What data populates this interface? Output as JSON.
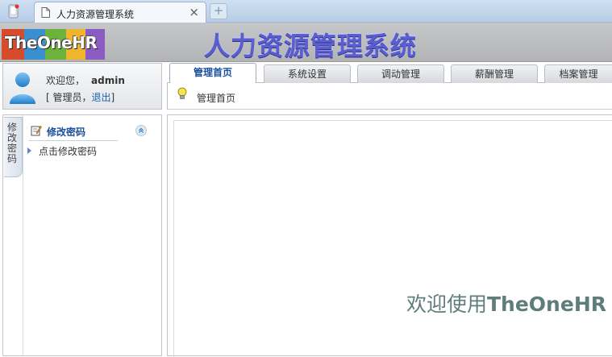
{
  "browser": {
    "tab_title": "人力资源管理系统",
    "close_label": "×",
    "new_tab_label": "+"
  },
  "header": {
    "logo_text": "TheOneHR",
    "system_title": "人力资源管理系统"
  },
  "user": {
    "welcome_label": "欢迎您，",
    "username": "admin",
    "role_prefix": "[ 管理员，",
    "logout_label": "退出",
    "role_suffix": "]"
  },
  "sidebar": {
    "vertical_tab": "修改密码",
    "menu_title": "修改密码",
    "items": [
      {
        "label": "点击修改密码"
      }
    ]
  },
  "main": {
    "tabs": [
      {
        "label": "管理首页",
        "active": true
      },
      {
        "label": "系统设置",
        "active": false
      },
      {
        "label": "调动管理",
        "active": false
      },
      {
        "label": "薪酬管理",
        "active": false
      },
      {
        "label": "档案管理",
        "active": false
      }
    ],
    "breadcrumb": "管理首页",
    "welcome_prefix": "欢迎使用",
    "welcome_brand": "TheOneHR"
  },
  "colors": {
    "accent": "#1a4f9c",
    "logo_blocks": [
      "#d84b2a",
      "#3a8fd0",
      "#6bb33a",
      "#f0b52c",
      "#8a5bc3"
    ]
  }
}
